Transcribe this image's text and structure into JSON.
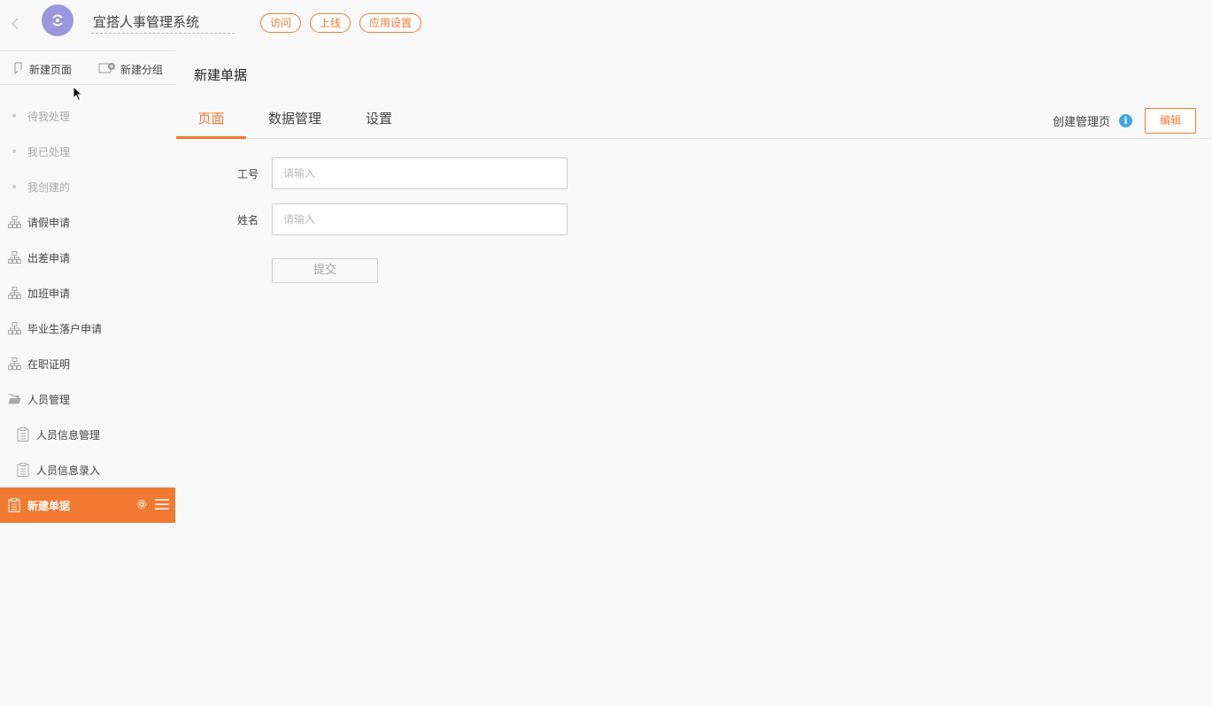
{
  "header": {
    "app_title": "宜搭人事管理系统",
    "pills": [
      "访问",
      "上线",
      "应用设置"
    ]
  },
  "sidebar": {
    "actions": {
      "new_page": "新建页面",
      "new_group": "新建分组"
    },
    "items": [
      {
        "label": "待我处理",
        "type": "dot"
      },
      {
        "label": "我已处理",
        "type": "dot"
      },
      {
        "label": "我创建的",
        "type": "dot"
      },
      {
        "label": "请假申请",
        "type": "process"
      },
      {
        "label": "出差申请",
        "type": "process"
      },
      {
        "label": "加班申请",
        "type": "process"
      },
      {
        "label": "毕业生落户申请",
        "type": "process"
      },
      {
        "label": "在职证明",
        "type": "process"
      },
      {
        "label": "人员管理",
        "type": "folder"
      },
      {
        "label": "人员信息管理",
        "type": "form-sub"
      },
      {
        "label": "人员信息录入",
        "type": "form-sub"
      },
      {
        "label": "新建单据",
        "type": "form-active"
      }
    ]
  },
  "main": {
    "title": "新建单据",
    "tabs": [
      "页面",
      "数据管理",
      "设置"
    ],
    "create_manage_label": "创建管理页",
    "edit_label": "编辑",
    "form": {
      "fields": [
        {
          "label": "工号",
          "placeholder": "请输入"
        },
        {
          "label": "姓名",
          "placeholder": "请输入"
        }
      ],
      "submit_label": "提交"
    }
  }
}
